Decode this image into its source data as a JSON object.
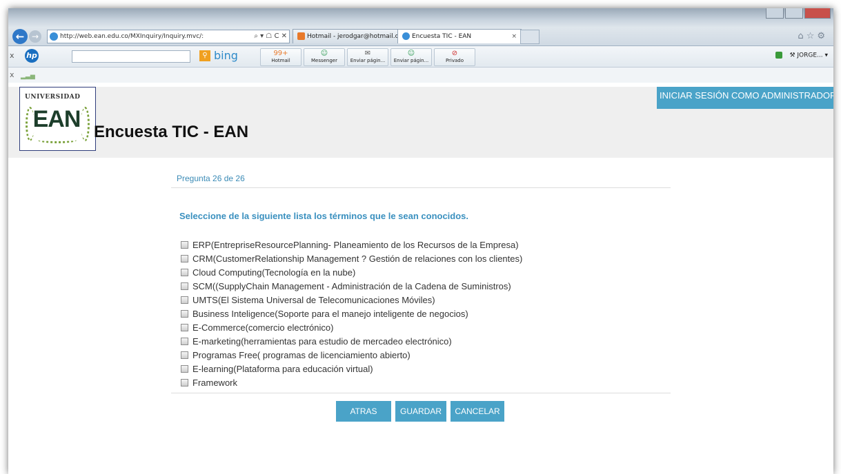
{
  "browser": {
    "address": "http://web.ean.edu.co/MXInquiry/Inquiry.mvc/:",
    "address_controls": "⌕ ▾ ☖ C ✕",
    "tabs": [
      {
        "label": "Hotmail - jerodgar@hotmail.c...",
        "close": ""
      },
      {
        "label": "Encuesta TIC - EAN",
        "close": "×"
      }
    ],
    "toolbar": {
      "close_x": "x",
      "hp_logo": "hp",
      "bing_label": "bing",
      "buttons": [
        {
          "icon": "99+",
          "label": "Hotmail"
        },
        {
          "icon": "☺",
          "label": "Messenger"
        },
        {
          "icon": "✉",
          "label": "Enviar págin..."
        },
        {
          "icon": "☺",
          "label": "Enviar págin..."
        },
        {
          "icon": "⊘",
          "label": "Privado"
        }
      ],
      "user": "JORGE... ▾"
    },
    "status_x": "x"
  },
  "header": {
    "logo_small": "UNIVERSIDAD",
    "logo_big": "EAN",
    "title": "Encuesta TIC - EAN",
    "admin_button": "INICIAR SESIÓN COMO ADMINISTRADOR"
  },
  "survey": {
    "question_number": "Pregunta 26 de 26",
    "question": "Seleccione de la siguiente lista los términos que le sean conocidos.",
    "options": [
      "ERP(Entreprise​ResourcePlanning- Planeamiento de los Recursos de la Empresa)",
      "CRM(CustomerRelationship Management ? Gestión de relaciones con los clientes)",
      "Cloud Computing(Tecnología en la nube)",
      "SCM((SupplyChain Management - Administración de la Cadena de Suministros)",
      "UMTS(El Sistema Universal de Telecomunicaciones Móviles)",
      "Business Inteligence(Soporte para el manejo inteligente de negocios)",
      "E-Commerce(comercio electrónico)",
      "E-marketing(herramientas para estudio de mercadeo electrónico)",
      "Programas Free( programas de licenciamiento abierto)",
      "E-learning(Plataforma para educación virtual)",
      "Framework"
    ],
    "buttons": {
      "back": "ATRAS",
      "save": "GUARDAR",
      "cancel": "CANCELAR"
    }
  },
  "colors": {
    "accent": "#4aa3c8",
    "question_text": "#3a90bf"
  }
}
